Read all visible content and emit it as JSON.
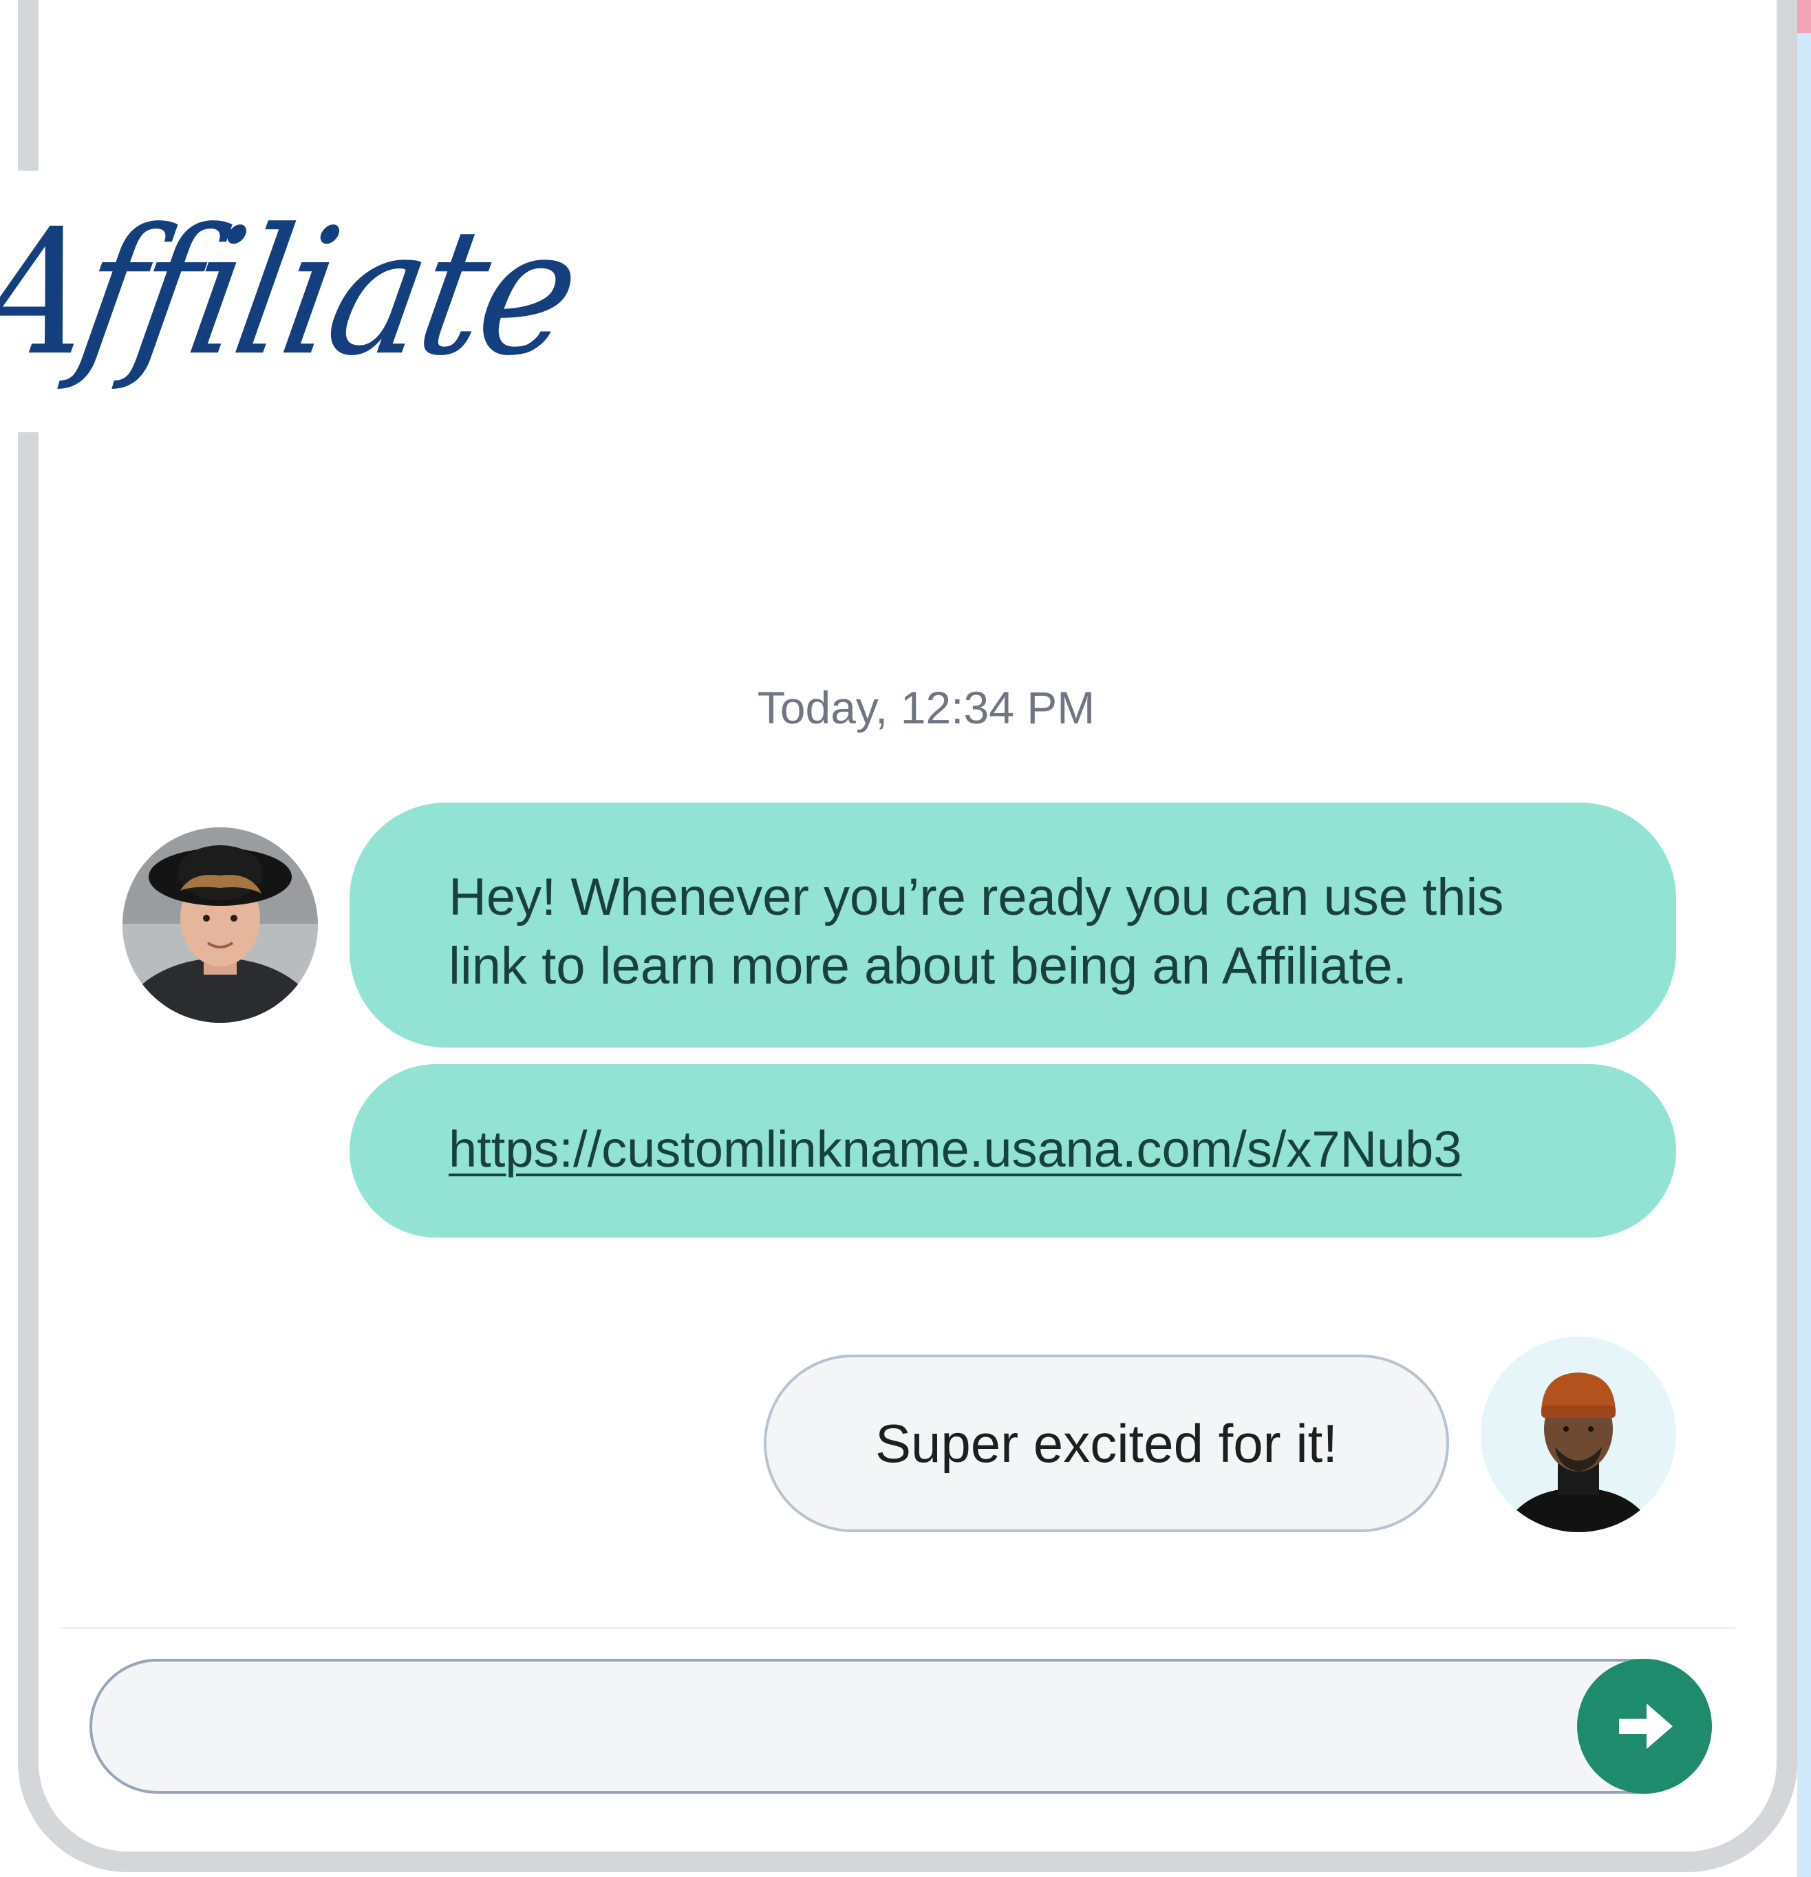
{
  "header": {
    "title": "Affiliate"
  },
  "chat": {
    "timestamp": "Today, 12:34 PM",
    "messages": [
      {
        "sender": "agent",
        "text": "Hey! Whenever you’re ready you can use this link to learn more about being an Affiliate."
      },
      {
        "sender": "agent",
        "link": "https://customlinkname.usana.com/s/x7Nub3"
      },
      {
        "sender": "user",
        "text": "Super excited for it!"
      }
    ]
  },
  "composer": {
    "value": "",
    "placeholder": "",
    "send_icon": "arrow-right-circle-icon"
  },
  "colors": {
    "title": "#143f7e",
    "agent_bubble": "#92e3d3",
    "user_bubble": "#f4f5f7",
    "send_button": "#1e8c6c",
    "frame": "#d4d6d9"
  }
}
